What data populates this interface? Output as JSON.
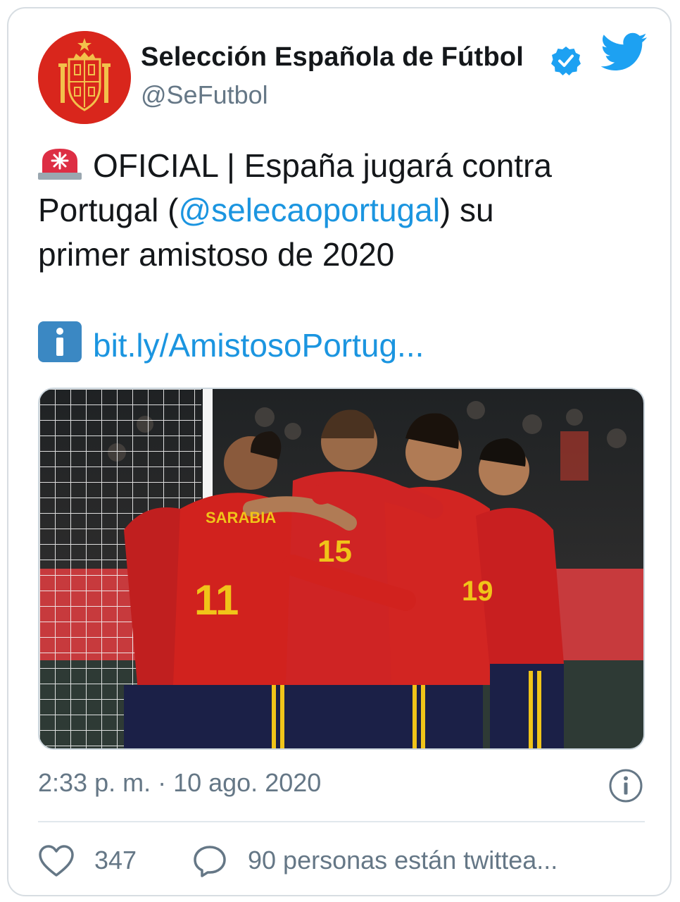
{
  "account": {
    "display_name": "Selección Española de Fútbol",
    "handle": "@SeFutbol",
    "verified": true
  },
  "icons": {
    "avatar": "spain-football-crest",
    "verified": "verified-badge-icon",
    "brand": "twitter-bird-icon",
    "siren": "rotating-light-emoji",
    "info": "information-emoji",
    "about": "info-circle-icon",
    "like": "heart-icon",
    "reply": "speech-bubble-icon"
  },
  "tweet": {
    "line1": "OFICIAL | España jugará contra",
    "line2_start": "Portugal (",
    "mention": "@selecaoportugal",
    "line2_end": ") su",
    "line3": "primer amistoso de 2020",
    "link": "bit.ly/AmistosoPortug..."
  },
  "meta": {
    "timestamp": "2:33 p. m. · 10 ago. 2020",
    "likes": "347",
    "talking": "90 personas están twittea..."
  },
  "colors": {
    "text": "#14171a",
    "secondary": "#657786",
    "link": "#1b95e0",
    "brand_blue": "#1da1f2",
    "crest_red": "#d9261c"
  }
}
